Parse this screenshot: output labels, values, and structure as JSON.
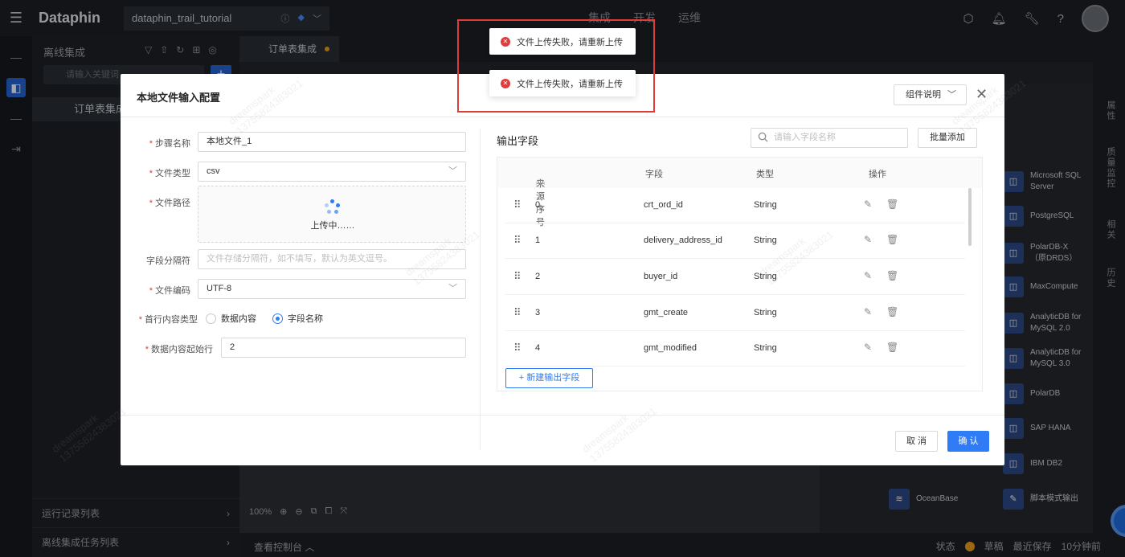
{
  "app": {
    "logo": "Dataphin",
    "project": "dataphin_trail_tutorial",
    "topnav": [
      "集成",
      "开发",
      "运维"
    ]
  },
  "sidebar": {
    "title": "离线集成",
    "search_placeholder": "请输入关键词",
    "tree_item": "订单表集成",
    "bottom_items": [
      "运行记录列表",
      "离线集成任务列表"
    ]
  },
  "editor": {
    "tab_label": "订单表集成",
    "zoom": "100%"
  },
  "console": {
    "label": "查看控制台",
    "status_label": "状态",
    "status_value": "草稿",
    "last_save_label": "最近保存",
    "last_save_value": "10分钟前"
  },
  "components": [
    "Microsoft SQL Server",
    "PostgreSQL",
    "PolarDB-X（原DRDS）",
    "MaxCompute",
    "AnalyticDB for MySQL 2.0",
    "AnalyticDB for MySQL 3.0",
    "PolarDB",
    "SAP HANA",
    "IBM DB2",
    "OceanBase",
    "脚本模式输出"
  ],
  "rightrail": [
    "属性",
    "质量监控",
    "相关",
    "历史"
  ],
  "modal": {
    "title": "本地文件输入配置",
    "help_label": "组件说明",
    "fields": {
      "step_name_label": "步骤名称",
      "step_name_value": "本地文件_1",
      "file_type_label": "文件类型",
      "file_type_value": "csv",
      "file_path_label": "文件路径",
      "uploading_text": "上传中……",
      "separator_label": "字段分隔符",
      "separator_placeholder": "文件存储分隔符，如不填写，默认为英文逗号。",
      "encoding_label": "文件编码",
      "encoding_value": "UTF-8",
      "first_row_label": "首行内容类型",
      "first_row_options": [
        "数据内容",
        "字段名称"
      ],
      "first_row_selected": "字段名称",
      "start_row_label": "数据内容起始行",
      "start_row_value": "2"
    },
    "output": {
      "title": "输出字段",
      "search_placeholder": "请输入字段名称",
      "batch_add": "批量添加",
      "columns": [
        "来源序号",
        "字段",
        "类型",
        "操作"
      ],
      "rows": [
        {
          "index": "0",
          "field": "crt_ord_id",
          "type": "String"
        },
        {
          "index": "1",
          "field": "delivery_address_id",
          "type": "String"
        },
        {
          "index": "2",
          "field": "buyer_id",
          "type": "String"
        },
        {
          "index": "3",
          "field": "gmt_create",
          "type": "String"
        },
        {
          "index": "4",
          "field": "gmt_modified",
          "type": "String"
        }
      ],
      "add_field": "新建输出字段"
    },
    "cancel": "取 消",
    "confirm": "确 认"
  },
  "toasts": [
    "文件上传失败，请重新上传",
    "文件上传失败，请重新上传"
  ],
  "colors": {
    "primary": "#2f7cf6",
    "error": "#e03c3c",
    "draft": "#f0a020"
  }
}
